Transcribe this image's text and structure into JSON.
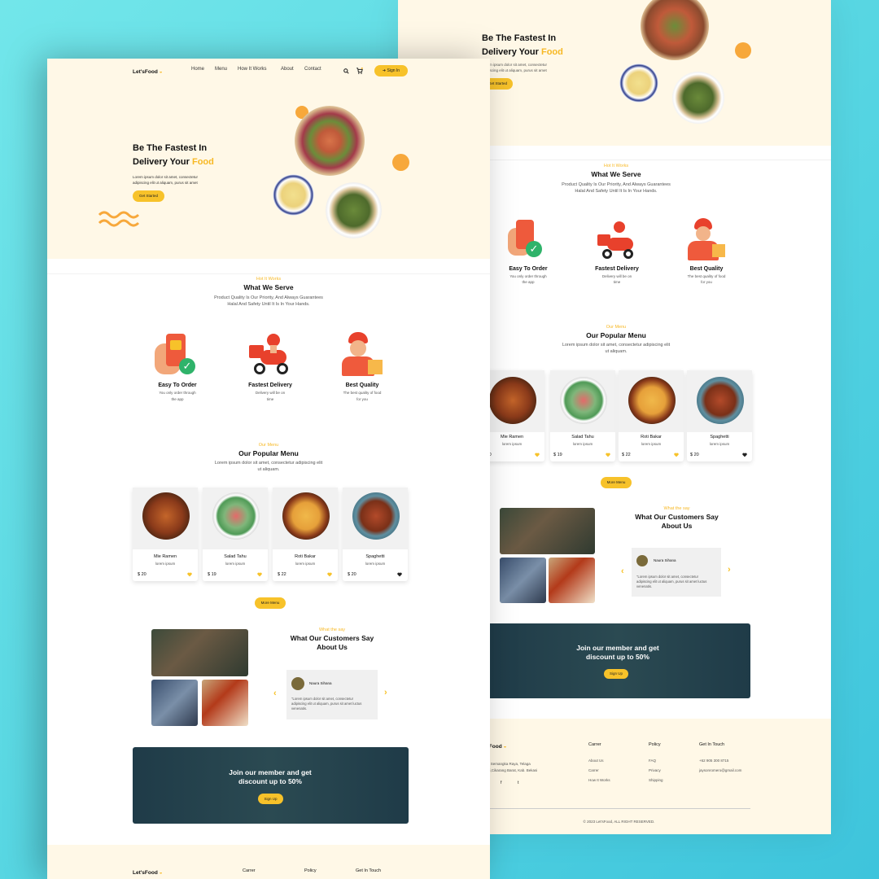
{
  "brand": {
    "name": "Let'sFood"
  },
  "nav": {
    "home": "Home",
    "menu": "Menu",
    "how": "How It Works",
    "about": "About",
    "contact": "Contact",
    "signin": "Sign In"
  },
  "hero": {
    "line1": "Be The Fastest In",
    "line2_prefix": "Delivery Your ",
    "line2_highlight": "Food",
    "sub1": "Lorem ipsum dolor sit amet, consectetur",
    "sub2": "adipiscing elit ut aliquam, purus sit amet",
    "cta": "Get Started",
    "back_sub1": "Lorem ipsum dolor sit amet, consectetur",
    "back_sub2": "adipiscing elit ut aliquam, purus sit amet"
  },
  "serve": {
    "eyebrow": "Hot It Works",
    "title": "What We Serve",
    "desc1": "Product Quality Is Our Priority, And Always Guarantees",
    "desc2": "Halal And Safety Until It Is In Your Hands.",
    "items": [
      {
        "title": "Easy To Order",
        "d1": "You only order through",
        "d2": "the app"
      },
      {
        "title": "Fastest Delivery",
        "d1": "Delivery will be on",
        "d2": "time"
      },
      {
        "title": "Best Quality",
        "d1": "The best quality of food",
        "d2": "for you"
      }
    ]
  },
  "menu": {
    "eyebrow": "Our Menu",
    "title": "Our Popular Menu",
    "desc1": "Lorem ipsum dolor sit amet, consectetur adipiscing elit",
    "desc2": "ut aliquam.",
    "items": [
      {
        "name": "Mie Ramen",
        "sub": "lorem ipsum",
        "price": "$ 20"
      },
      {
        "name": "Salad Tahu",
        "sub": "lorem ipsum",
        "price": "$ 19"
      },
      {
        "name": "Roti Bakar",
        "sub": "lorem ipsum",
        "price": "$ 22"
      },
      {
        "name": "Spaghetti",
        "sub": "lorem ipsum",
        "price": "$ 20"
      }
    ],
    "more": "More Menu"
  },
  "testimonial": {
    "eyebrow": "What the say",
    "title1": "What Our Customers Say",
    "title2": "About Us",
    "name": "Naura Sihana",
    "q1": "\"Lorem ipsum dolor sit amet, consectetur",
    "q2": "adipiscing elit ut aliquam, purus sit amet luctus",
    "q3": "venenatis."
  },
  "cta": {
    "line1": "Join our member and get",
    "line2": "discount up to 50%",
    "button": "Sign Up"
  },
  "footer": {
    "carrer": "Carrer",
    "policy": "Policy",
    "touch": "Get In Touch",
    "addr1": "n Semangka Raya, Telaga",
    "addr2": "ni,Cikarang Barat, Kab. Bekasi",
    "c1": "About Us",
    "c2": "Carrer",
    "c3": "How It Works",
    "p1": "FAQ",
    "p2": "Privacy",
    "p3": "Shipping",
    "phone": "+62 905 300 8715",
    "email": "jaysonromero@gmail.com",
    "copy": "© 2023 Let'sFood, ALL RIGHT RESERVED.",
    "front_brand": "Let'sFood"
  },
  "colors": {
    "accent": "#f7c22a",
    "cream": "#fff8e7",
    "highlight": "#f7b824",
    "dark": "#1f3b48"
  }
}
